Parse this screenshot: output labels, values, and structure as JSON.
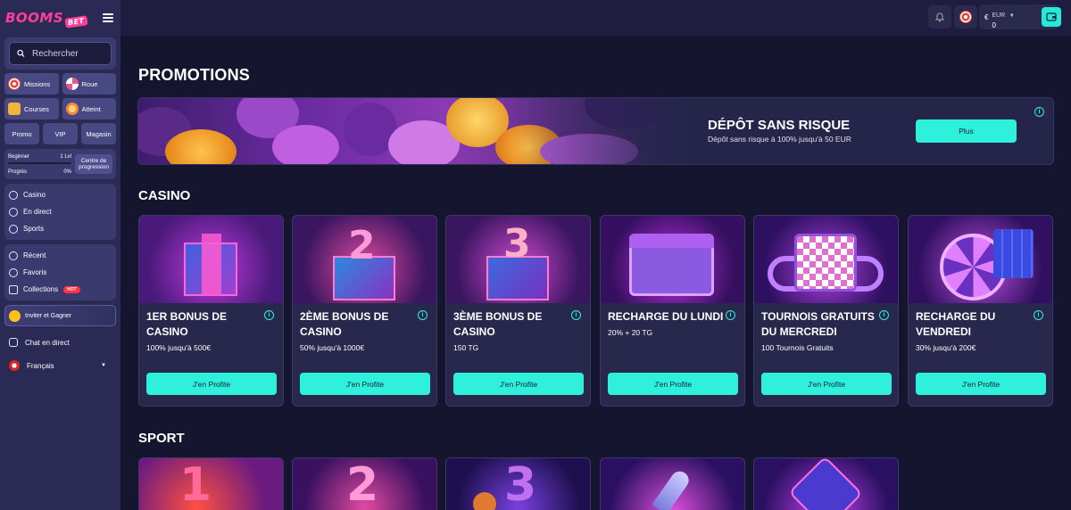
{
  "logo": {
    "text": "BOOMS",
    "tag": "BET"
  },
  "sidebar": {
    "search_placeholder": "Rechercher",
    "quick": [
      {
        "label": "Missions",
        "icon": "target-icon",
        "color": "#e8453c"
      },
      {
        "label": "Roue",
        "icon": "wheel-icon",
        "color": "#e85a8a"
      },
      {
        "label": "Courses",
        "icon": "trophy-icon",
        "color": "#f0b43a"
      },
      {
        "label": "Atteint",
        "icon": "medal-icon",
        "color": "#f08a3a"
      }
    ],
    "row3": [
      "Promo",
      "VIP",
      "Magasin"
    ],
    "progress": {
      "level": "Beginner",
      "lvl": "1 Lvl",
      "label": "Progrès",
      "percent": "0%",
      "center": "Centre de progression"
    },
    "nav1": [
      "Casino",
      "En direct",
      "Sports"
    ],
    "nav2": [
      "Récent",
      "Favoris",
      "Collections"
    ],
    "hot_badge": "HOT",
    "invite": "Inviter et Gagner",
    "chat": "Chat en direct",
    "language": "Français"
  },
  "topbar": {
    "currency": "EUR",
    "balance": "0"
  },
  "page": {
    "title": "PROMOTIONS",
    "banner": {
      "title": "DÉPÔT SANS RISQUE",
      "subtitle": "Dépôt sans risque à 100% jusqu'à 50 EUR",
      "button": "Plus"
    },
    "casino_heading": "CASINO",
    "sport_heading": "SPORT",
    "cards": [
      {
        "title": "1ER BONUS DE CASINO",
        "desc": "100% jusqu'à 500€",
        "button": "J'en Profite",
        "art": "1"
      },
      {
        "title": "2ÈME BONUS DE CASINO",
        "desc": "50% jusqu'à 1000€",
        "button": "J'en Profite",
        "art": "2"
      },
      {
        "title": "3ÈME BONUS DE CASINO",
        "desc": "150 TG",
        "button": "J'en Profite",
        "art": "3"
      },
      {
        "title": "RECHARGE DU LUNDI",
        "desc": "20% + 20 TG",
        "button": "J'en Profite",
        "art": "cal"
      },
      {
        "title": "TOURNOIS GRATUITS DU MERCREDI",
        "desc": "100 Tournois Gratuits",
        "button": "J'en Profite",
        "art": "cal2"
      },
      {
        "title": "RECHARGE DU VENDREDI",
        "desc": "30% jusqu'à 200€",
        "button": "J'en Profite",
        "art": "roulette"
      }
    ]
  }
}
